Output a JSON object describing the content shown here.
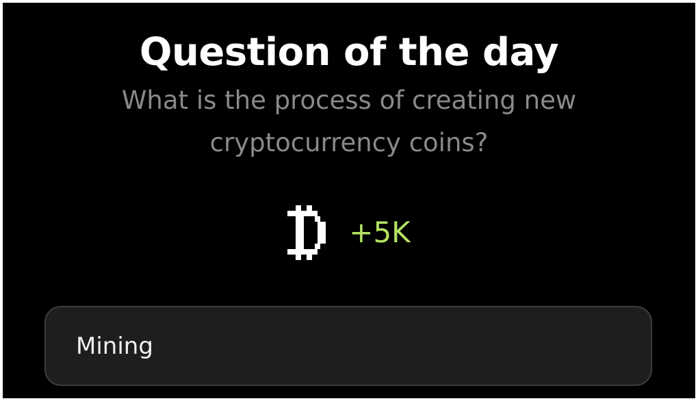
{
  "quiz": {
    "title": "Question of the day",
    "question": "What is the process of creating new cryptocurrency coins?",
    "reward": {
      "icon": "bitcoin-pixel-icon",
      "amount": "+5K",
      "color": "#b5e363"
    },
    "answer": {
      "label": "Mining"
    }
  }
}
